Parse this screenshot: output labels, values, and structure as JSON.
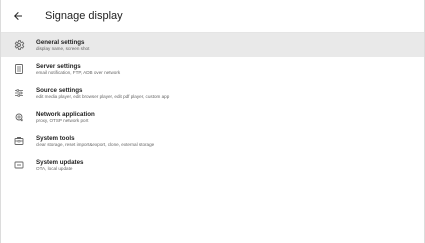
{
  "app_bar": {
    "back_icon": "arrow-back-icon",
    "title": "Signage display"
  },
  "settings": {
    "items": [
      {
        "icon": "gear-icon",
        "title": "General settings",
        "subtitle": "display name, screen shot",
        "selected": true
      },
      {
        "icon": "server-icon",
        "title": "Server settings",
        "subtitle": "email notification, FTP, ADB over network",
        "selected": false
      },
      {
        "icon": "sliders-icon",
        "title": "Source settings",
        "subtitle": "edit media player, edit browser player, edit pdf player, custom app",
        "selected": false
      },
      {
        "icon": "network-icon",
        "title": "Network application",
        "subtitle": "proxy, OTSP network port",
        "selected": false
      },
      {
        "icon": "toolbox-icon",
        "title": "System tools",
        "subtitle": "clear storage, reset import&export, clone, external storage",
        "selected": false
      },
      {
        "icon": "system-update-icon",
        "title": "System updates",
        "subtitle": "OTA, local update",
        "selected": false
      }
    ]
  },
  "colors": {
    "background": "#ffffff",
    "selected_row": "#e9e9e9",
    "primary_text": "#1f1f1f",
    "secondary_text": "#666666",
    "icon": "#666666"
  }
}
